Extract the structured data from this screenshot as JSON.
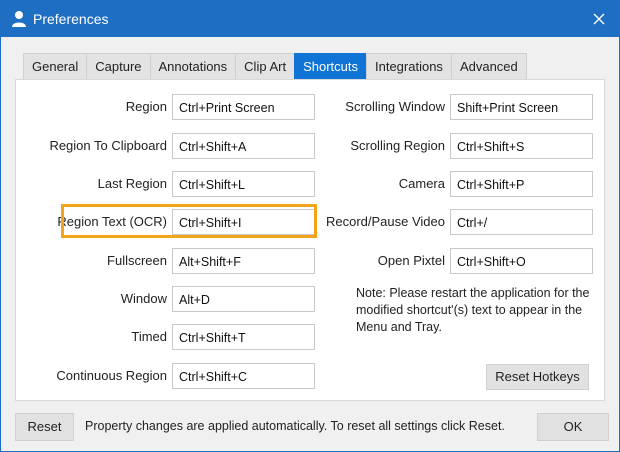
{
  "window": {
    "title": "Preferences"
  },
  "tabs": [
    {
      "label": "General"
    },
    {
      "label": "Capture"
    },
    {
      "label": "Annotations"
    },
    {
      "label": "Clip Art"
    },
    {
      "label": "Shortcuts",
      "active": true
    },
    {
      "label": "Integrations"
    },
    {
      "label": "Advanced"
    }
  ],
  "shortcuts_left": [
    {
      "label": "Region",
      "value": "Ctrl+Print Screen"
    },
    {
      "label": "Region To Clipboard",
      "value": "Ctrl+Shift+A"
    },
    {
      "label": "Last Region",
      "value": "Ctrl+Shift+L"
    },
    {
      "label": "Region Text (OCR)",
      "value": "Ctrl+Shift+I"
    },
    {
      "label": "Fullscreen",
      "value": "Alt+Shift+F"
    },
    {
      "label": "Window",
      "value": "Alt+D"
    },
    {
      "label": "Timed",
      "value": "Ctrl+Shift+T"
    },
    {
      "label": "Continuous Region",
      "value": "Ctrl+Shift+C"
    }
  ],
  "shortcuts_right": [
    {
      "label": "Scrolling Window",
      "value": "Shift+Print Screen"
    },
    {
      "label": "Scrolling Region",
      "value": "Ctrl+Shift+S"
    },
    {
      "label": "Camera",
      "value": "Ctrl+Shift+P"
    },
    {
      "label": "Record/Pause Video",
      "value": "Ctrl+/"
    },
    {
      "label": "Open Pixtel",
      "value": "Ctrl+Shift+O"
    }
  ],
  "note": "Note: Please restart the application for the modified shortcut'(s) text to appear in the Menu and Tray.",
  "buttons": {
    "reset_hotkeys": "Reset Hotkeys",
    "reset": "Reset",
    "ok": "OK"
  },
  "status": "Property changes are applied automatically. To reset all settings click Reset.",
  "colors": {
    "titlebar": "#1e6fc4",
    "active_tab": "#0f74d6",
    "highlight": "#f2a51a"
  }
}
